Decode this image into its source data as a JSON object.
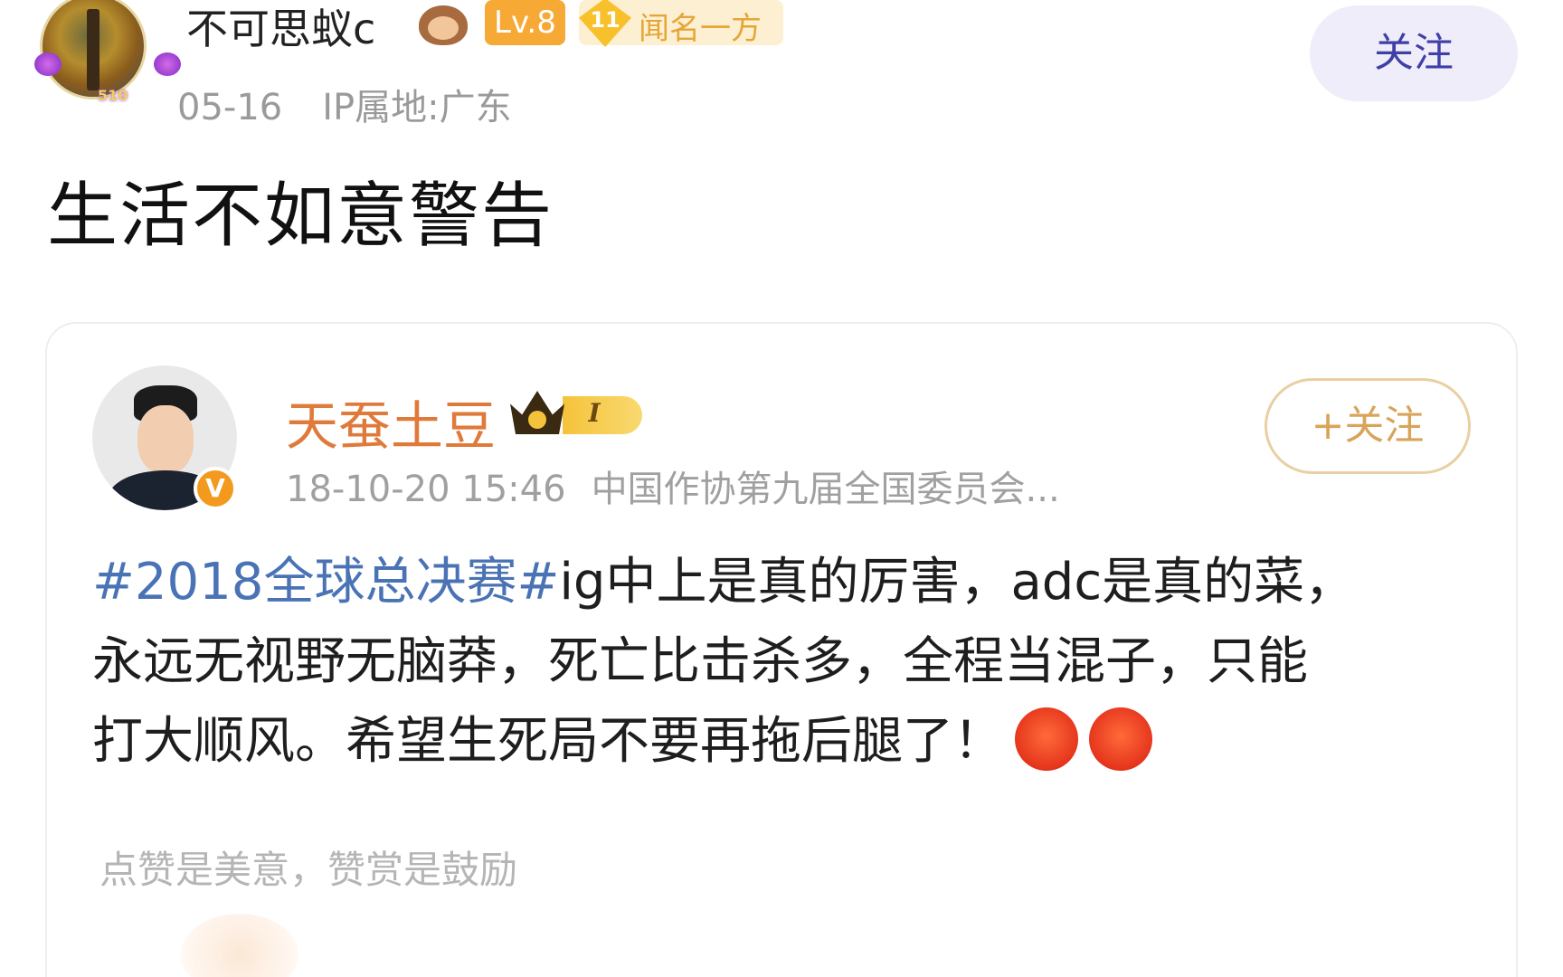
{
  "post": {
    "username": "不可思蚁c",
    "level_badge": "Lv.8",
    "fan_badge_number": "11",
    "fan_badge_text": "闻名一方",
    "avatar_tag": "510",
    "date": "05-16",
    "ip_location": "IP属地:广东",
    "follow_label": "关注",
    "text": "生活不如意警告"
  },
  "repost": {
    "username": "天蚕土豆",
    "crown_level": "I",
    "verified_mark": "V",
    "timestamp": "18-10-20 15:46",
    "source": "中国作协第九届全国委员会...",
    "follow_label": "+关注",
    "hashtag": "#2018全球总决赛#",
    "line1_rest": "ig中上是真的厉害，adc是真的菜，",
    "line2": "永远无视野无脑莽，死亡比击杀多，全程当混子，只能",
    "line3": "打大顺风。希望生死局不要再拖后腿了！",
    "emojis": [
      "angry-face-icon",
      "angry-face-icon"
    ],
    "reward_text": "点赞是美意，赞赏是鼓励"
  },
  "colors": {
    "hashtag": "#4a73b5",
    "repost_username": "#e07a3a",
    "follow_outer_text": "#3f3fa8",
    "follow_inner_border": "#e9cfa3"
  }
}
